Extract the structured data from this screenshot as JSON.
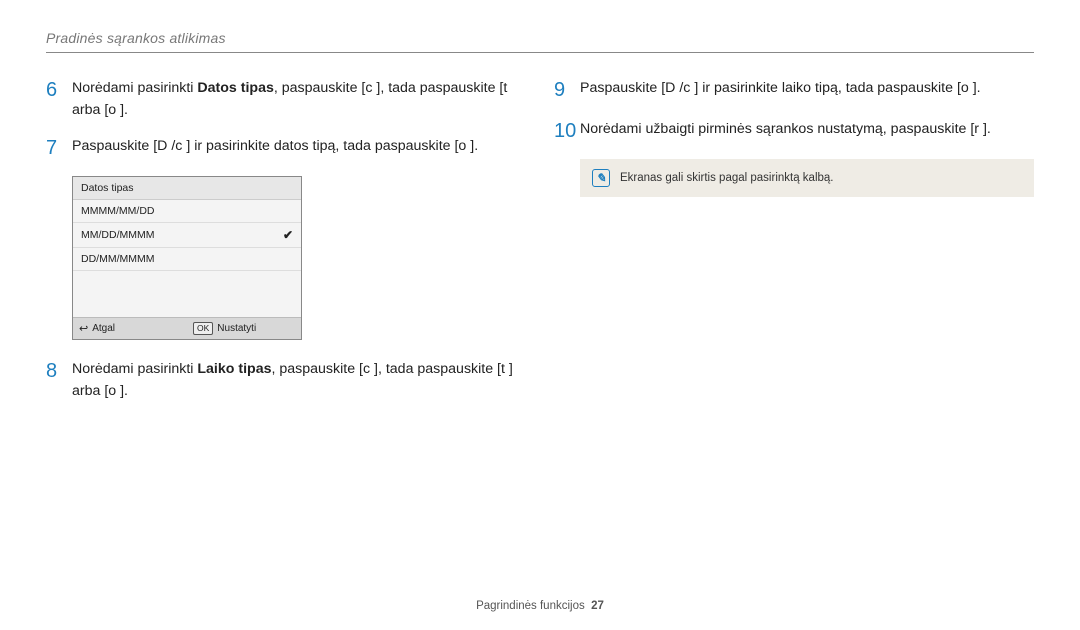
{
  "header": {
    "title": "Pradinės sąrankos atlikimas"
  },
  "left": {
    "step6": {
      "num": "6",
      "pre": "Norėdami pasirinkti ",
      "bold": "Datos tipas",
      "post": ", paspauskite [c    ], tada paspauskite [t    arba [o     ]."
    },
    "step7": {
      "num": "7",
      "text": "Paspauskite [D        /c    ] ir pasirinkite datos tipą, tada paspauskite [o     ]."
    },
    "screen": {
      "title": "Datos tipas",
      "rows": [
        "MMMM/MM/DD",
        "MM/DD/MMMM",
        "DD/MM/MMMM"
      ],
      "checkedIndex": 1,
      "backLabel": "Atgal",
      "okLabel": "Nustatyti",
      "okKey": "OK"
    },
    "step8": {
      "num": "8",
      "pre": "Norėdami pasirinkti ",
      "bold": "Laiko tipas",
      "post": ", paspauskite [c    ], tada paspauskite [t    ] arba [o     ]."
    }
  },
  "right": {
    "step9": {
      "num": "9",
      "text": "Paspauskite [D        /c    ] ir pasirinkite laiko tipą, tada paspauskite [o     ]."
    },
    "step10": {
      "num": "10",
      "text": "Norėdami užbaigti pirminės sąrankos nustatymą, paspauskite [r      ]."
    },
    "note": {
      "text": "Ekranas gali skirtis pagal pasirinktą kalbą."
    }
  },
  "footer": {
    "section": "Pagrindinės funkcijos",
    "page": "27"
  }
}
